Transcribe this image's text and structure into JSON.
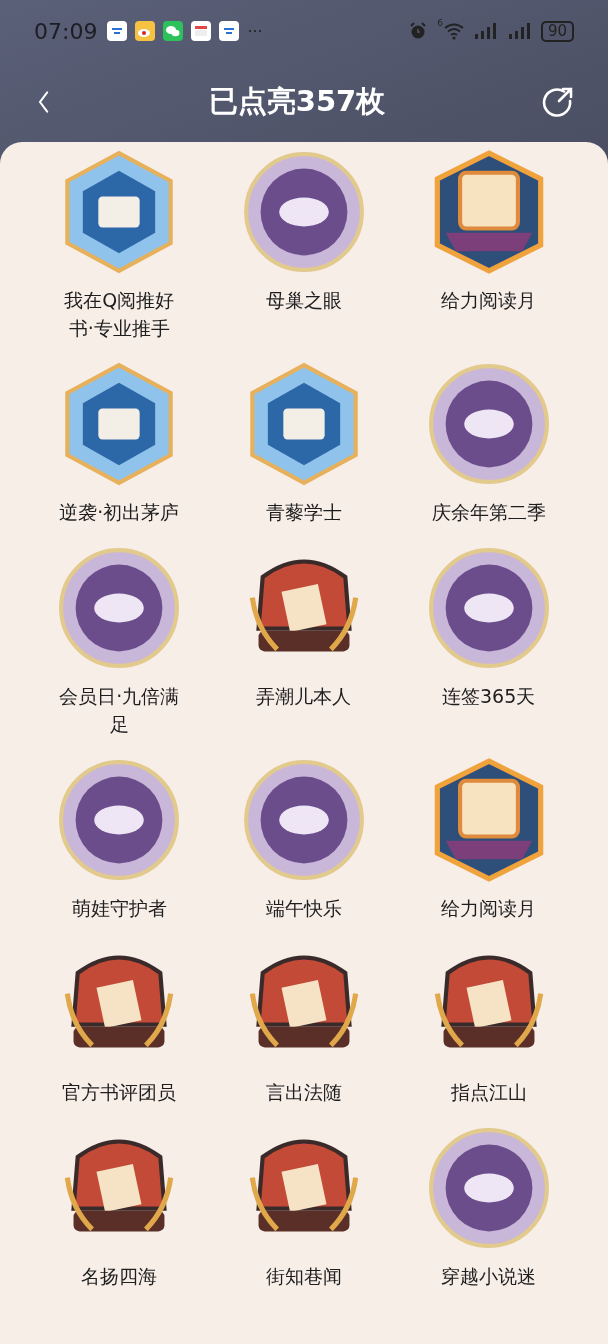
{
  "status_bar": {
    "time": "07:09",
    "more": "···",
    "wifi_label": "6",
    "battery": "90"
  },
  "header": {
    "title": "已点亮357枚"
  },
  "badges": [
    {
      "name": "我在Q阅推好书·专业推手",
      "kind": "hexagon"
    },
    {
      "name": "母巢之眼",
      "kind": "circle"
    },
    {
      "name": "给力阅读月",
      "kind": "shield"
    },
    {
      "name": "逆袭·初出茅庐",
      "kind": "hexagon"
    },
    {
      "name": "青藜学士",
      "kind": "hexagon"
    },
    {
      "name": "庆余年第二季",
      "kind": "circle"
    },
    {
      "name": "会员日·九倍满足",
      "kind": "circle"
    },
    {
      "name": "弄潮儿本人",
      "kind": "medal"
    },
    {
      "name": "连签365天",
      "kind": "circle"
    },
    {
      "name": "萌娃守护者",
      "kind": "circle"
    },
    {
      "name": "端午快乐",
      "kind": "circle"
    },
    {
      "name": "给力阅读月",
      "kind": "shield"
    },
    {
      "name": "官方书评团员",
      "kind": "medal"
    },
    {
      "name": "言出法随",
      "kind": "medal"
    },
    {
      "name": "指点江山",
      "kind": "medal"
    },
    {
      "name": "名扬四海",
      "kind": "medal"
    },
    {
      "name": "街知巷闻",
      "kind": "medal"
    },
    {
      "name": "穿越小说迷",
      "kind": "circle"
    }
  ]
}
